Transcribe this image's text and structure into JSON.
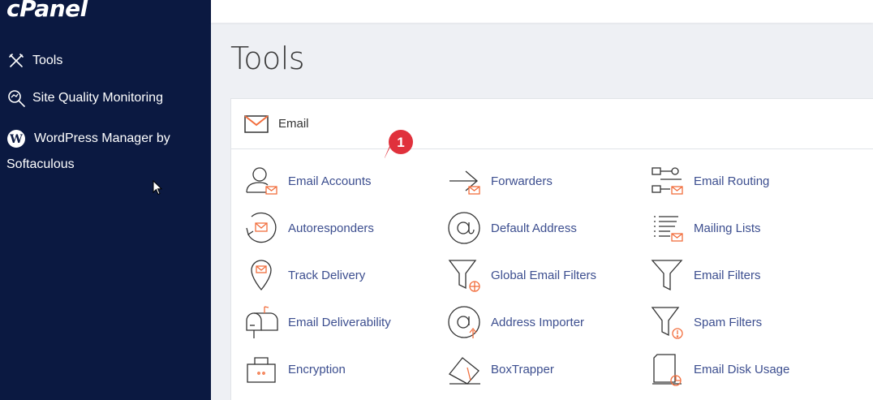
{
  "sidebar": {
    "logo": "cPanel",
    "items": [
      {
        "label": "Tools",
        "icon": "tools-icon"
      },
      {
        "label": "Site Quality Monitoring",
        "icon": "magnifier-icon"
      },
      {
        "label": "WordPress Manager by",
        "label2": "Softaculous",
        "icon": "wordpress-icon"
      }
    ]
  },
  "main": {
    "title": "Tools",
    "section": {
      "label": "Email",
      "icon": "envelope-icon",
      "tools": [
        {
          "label": "Email Accounts",
          "icon": "email-accounts-icon"
        },
        {
          "label": "Forwarders",
          "icon": "forwarders-icon"
        },
        {
          "label": "Email Routing",
          "icon": "email-routing-icon"
        },
        {
          "label": "Autoresponders",
          "icon": "autoresponders-icon"
        },
        {
          "label": "Default Address",
          "icon": "at-sign-icon"
        },
        {
          "label": "Mailing Lists",
          "icon": "mailing-lists-icon"
        },
        {
          "label": "Track Delivery",
          "icon": "track-delivery-icon"
        },
        {
          "label": "Global Email Filters",
          "icon": "global-filter-icon"
        },
        {
          "label": "Email Filters",
          "icon": "filter-icon"
        },
        {
          "label": "Email Deliverability",
          "icon": "mailbox-icon"
        },
        {
          "label": "Address Importer",
          "icon": "address-importer-icon"
        },
        {
          "label": "Spam Filters",
          "icon": "spam-filter-icon"
        },
        {
          "label": "Encryption",
          "icon": "encryption-icon"
        },
        {
          "label": "BoxTrapper",
          "icon": "boxtrapper-icon"
        },
        {
          "label": "Email Disk Usage",
          "icon": "disk-usage-icon"
        }
      ]
    }
  },
  "annotation": {
    "badge_number": "1",
    "color": "#e0313c"
  },
  "colors": {
    "sidebar_bg": "#0b1941",
    "link": "#3c4e8f",
    "accent": "#f26e3d"
  }
}
